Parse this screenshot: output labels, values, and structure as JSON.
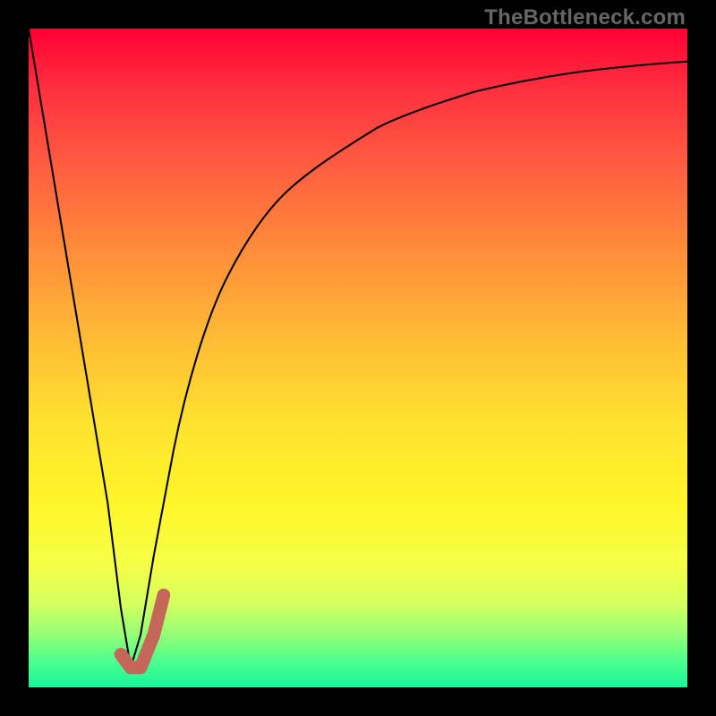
{
  "watermark": "TheBottleneck.com",
  "chart_data": {
    "type": "line",
    "title": "",
    "xlabel": "",
    "ylabel": "",
    "xlim": [
      0,
      100
    ],
    "ylim": [
      0,
      100
    ],
    "grid": false,
    "legend": false,
    "series": [
      {
        "name": "bottleneck-curve",
        "color": "#000000",
        "x": [
          0,
          3,
          6,
          9,
          12,
          14,
          15.5,
          17,
          19,
          22,
          26,
          30,
          35,
          40,
          46,
          53,
          60,
          68,
          76,
          84,
          92,
          100
        ],
        "values": [
          100,
          82,
          64,
          46,
          28,
          12,
          3,
          8,
          20,
          36,
          52,
          62,
          70,
          76,
          81,
          85,
          88,
          90.5,
          92.2,
          93.5,
          94.3,
          95
        ]
      },
      {
        "name": "highlight-segment",
        "color": "#c4675a",
        "x": [
          14,
          15.5,
          17,
          19,
          20.5
        ],
        "values": [
          5,
          3,
          3,
          8,
          14
        ]
      }
    ],
    "background_gradient": {
      "type": "vertical",
      "stops": [
        {
          "pos": 0.0,
          "color": "#ff0033"
        },
        {
          "pos": 0.33,
          "color": "#ff8a3a"
        },
        {
          "pos": 0.6,
          "color": "#ffe22f"
        },
        {
          "pos": 0.87,
          "color": "#d7ff5c"
        },
        {
          "pos": 1.0,
          "color": "#18f59a"
        }
      ]
    }
  }
}
